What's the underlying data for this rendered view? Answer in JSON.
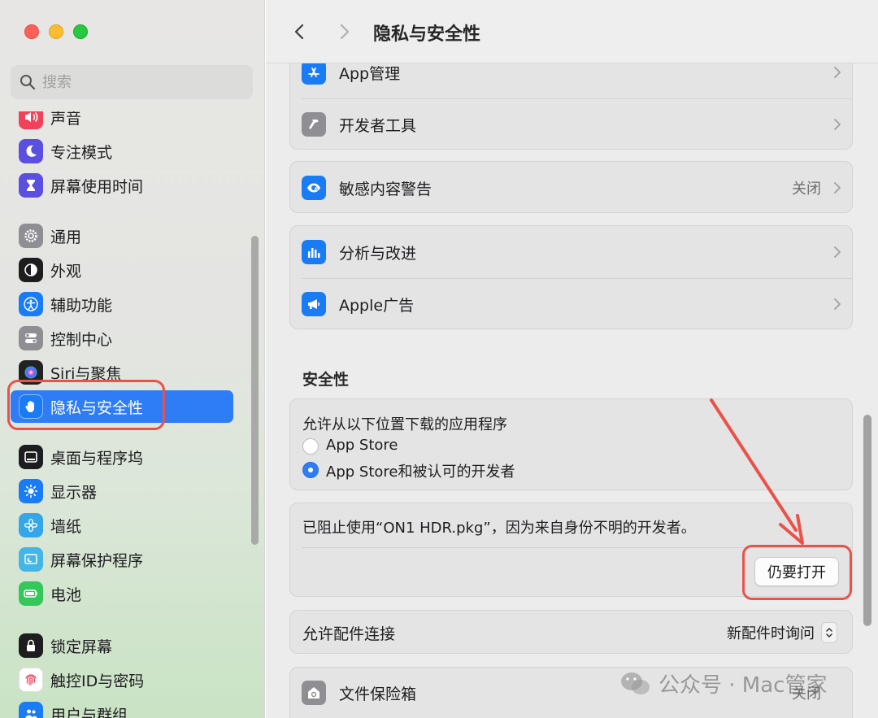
{
  "window": {
    "title": "隐私与安全性"
  },
  "search": {
    "placeholder": "搜索"
  },
  "sidebar": {
    "items": [
      {
        "label": "声音",
        "icon": "speaker-icon",
        "color": "#f2415a"
      },
      {
        "label": "专注模式",
        "icon": "moon-icon",
        "color": "#5a4fe0"
      },
      {
        "label": "屏幕使用时间",
        "icon": "hourglass-icon",
        "color": "#5a4fe0"
      },
      {
        "label": "通用",
        "icon": "gear-icon",
        "color": "#8e8e93"
      },
      {
        "label": "外观",
        "icon": "appearance-icon",
        "color": "#1d1d1f"
      },
      {
        "label": "辅助功能",
        "icon": "accessibility-icon",
        "color": "#1a7cf5"
      },
      {
        "label": "控制中心",
        "icon": "toggles-icon",
        "color": "#8e8e93"
      },
      {
        "label": "Siri与聚焦",
        "icon": "siri-icon",
        "color": "#222222"
      },
      {
        "label": "隐私与安全性",
        "icon": "hand-icon",
        "color": "#1a7cf5",
        "active": true
      },
      {
        "label": "桌面与程序坞",
        "icon": "dock-icon",
        "color": "#1d1d1f"
      },
      {
        "label": "显示器",
        "icon": "sun-icon",
        "color": "#1a7cf5"
      },
      {
        "label": "墙纸",
        "icon": "flower-icon",
        "color": "#35a7e8"
      },
      {
        "label": "屏幕保护程序",
        "icon": "screensaver-icon",
        "color": "#43b5e6"
      },
      {
        "label": "电池",
        "icon": "battery-icon",
        "color": "#34c759"
      },
      {
        "label": "锁定屏幕",
        "icon": "lock-icon",
        "color": "#1d1d1f"
      },
      {
        "label": "触控ID与密码",
        "icon": "fingerprint-icon",
        "color": "#ffffff"
      },
      {
        "label": "用户与群组",
        "icon": "users-icon",
        "color": "#1a7cf5"
      }
    ]
  },
  "main": {
    "rows_top": [
      {
        "label": "App管理",
        "icon": "appstore-icon"
      },
      {
        "label": "开发者工具",
        "icon": "hammer-icon"
      }
    ],
    "sensitive": {
      "label": "敏感内容警告",
      "value": "关闭",
      "icon": "eye-warning-icon"
    },
    "rows_analytics": [
      {
        "label": "分析与改进",
        "icon": "chart-icon"
      },
      {
        "label": "Apple广告",
        "icon": "megaphone-icon"
      }
    ],
    "security": {
      "title": "安全性",
      "allow_label": "允许从以下位置下载的应用程序",
      "options": [
        {
          "label": "App Store",
          "selected": false
        },
        {
          "label": "App Store和被认可的开发者",
          "selected": true
        }
      ],
      "blocked_message": "已阻止使用“ON1 HDR.pkg”，因为来自身份不明的开发者。",
      "open_anyway_label": "仍要打开"
    },
    "accessories": {
      "label": "允许配件连接",
      "value": "新配件时询问"
    },
    "filevault": {
      "label": "文件保险箱",
      "value": "关闭",
      "icon": "vault-icon"
    }
  },
  "watermark": {
    "text": "公众号 · Mac管家"
  },
  "colors": {
    "accent": "#2e7cf6",
    "annotation": "#e9524a"
  }
}
